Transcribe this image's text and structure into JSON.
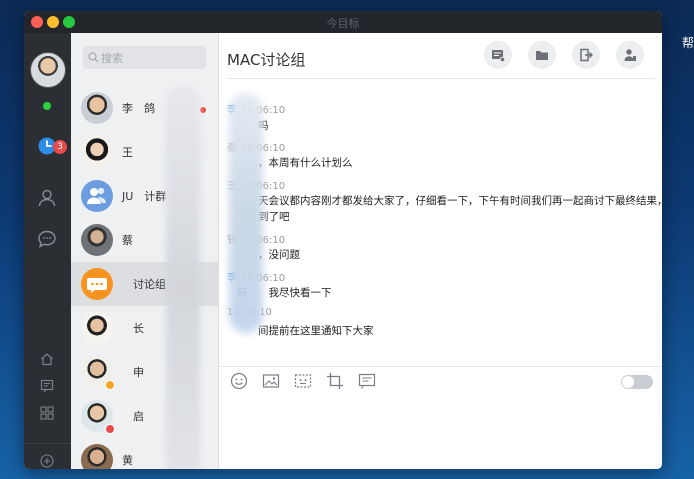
{
  "desktop": {
    "corner_text": "帮"
  },
  "window": {
    "title": "今目标"
  },
  "sidebar": {
    "notification_count": "3",
    "icons": [
      "clock-icon",
      "person-icon",
      "chat-bubble-icon",
      "home-icon",
      "note-icon",
      "grid-icon",
      "plus-icon"
    ]
  },
  "contacts": {
    "search_placeholder": "搜索",
    "items": [
      {
        "name": "李　鸽",
        "unread": true
      },
      {
        "name": "王",
        "unread": false
      },
      {
        "name": "JU　计群",
        "unread": false
      },
      {
        "name": "蔡",
        "unread": false
      },
      {
        "name": "　讨论组",
        "unread": false,
        "selected": true
      },
      {
        "name": "　长",
        "unread": false
      },
      {
        "name": "　申",
        "unread": false
      },
      {
        "name": "　启",
        "unread": false
      },
      {
        "name": "黄",
        "unread": false
      }
    ]
  },
  "chat": {
    "title": "MAC讨论组",
    "header_buttons": [
      "conversation-record-icon",
      "folder-icon",
      "exit-icon",
      "members-icon"
    ],
    "messages": [
      {
        "sender": "李",
        "time": "13:06:10",
        "text": "　　吗",
        "highlight": true
      },
      {
        "sender": "秦",
        "time": "13:06:10",
        "text": "　　，本周有什么计划么",
        "highlight": false
      },
      {
        "sender": "王",
        "time": "13:06:10",
        "text": "　　天会议都内容刚才都发给大家了，仔细看一下，下午有时间我们再一起商讨下最终结果，",
        "text2": "　　到了吧",
        "highlight": false
      },
      {
        "sender": "钱",
        "time": "13:06:10",
        "text": "　　，没问题",
        "highlight": false
      },
      {
        "sender": "李",
        "time": "13:06:10",
        "text": "好　　我尽快看一下",
        "highlight": true
      },
      {
        "sender": "",
        "time": "13:06:10",
        "text": "　　间提前在这里通知下大家",
        "highlight": false
      }
    ],
    "toolbar": [
      "emoji-icon",
      "image-icon",
      "screenshot-icon",
      "crop-icon",
      "message-record-icon"
    ],
    "toggle_on": false
  },
  "colors": {
    "accent": "#3a8ee6",
    "badge": "#e94a4a",
    "online": "#2bd142"
  }
}
